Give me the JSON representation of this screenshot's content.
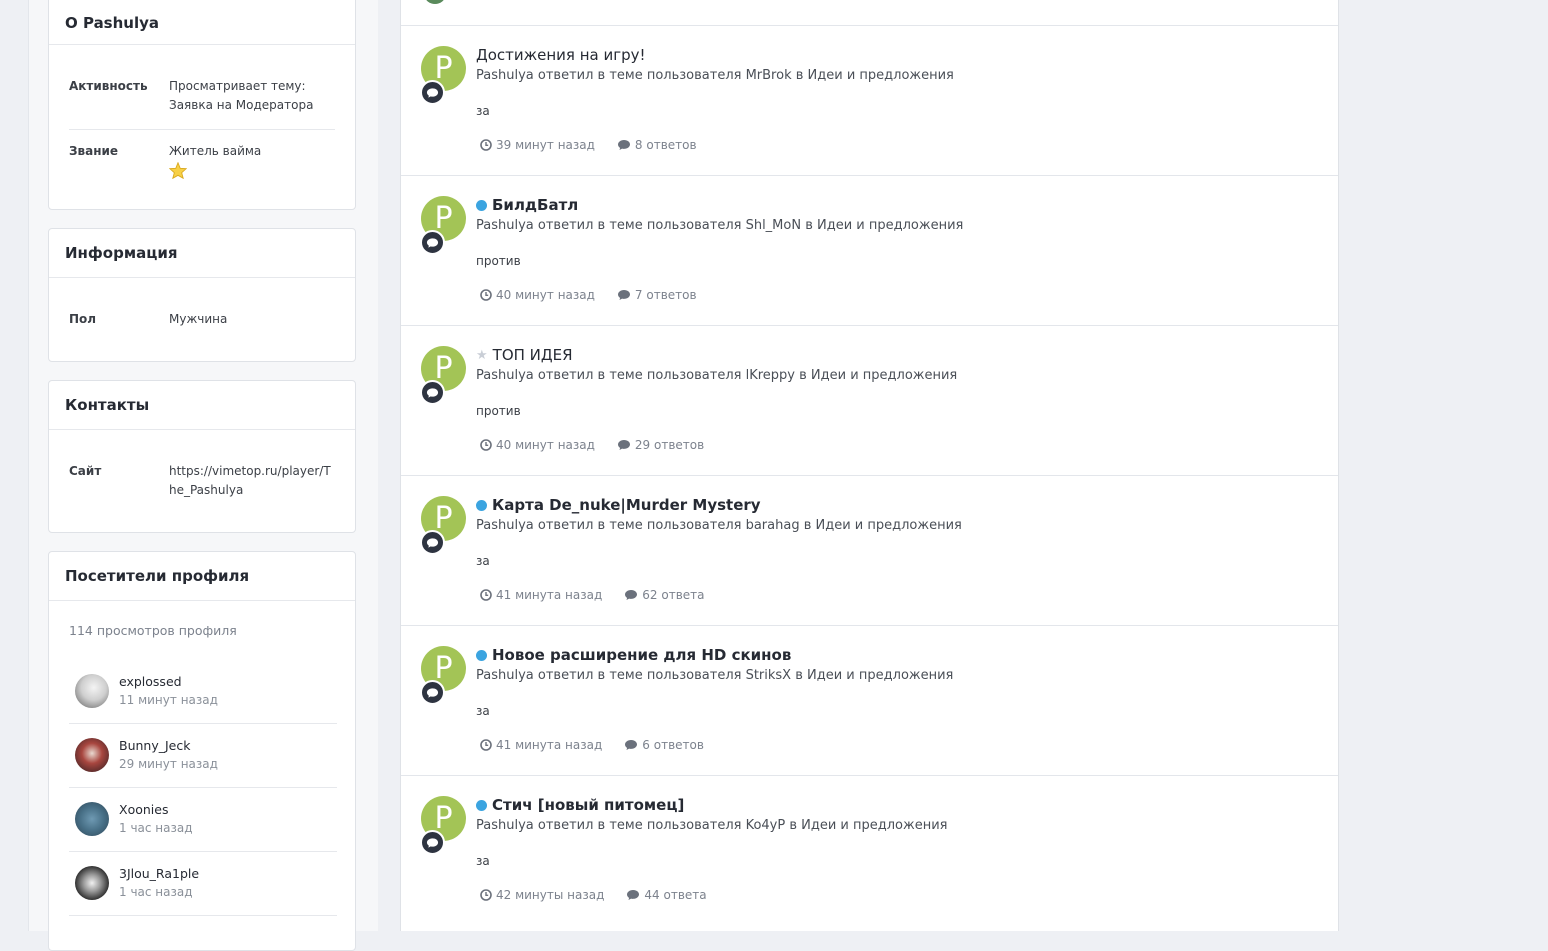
{
  "about": {
    "title": "О Pashulya",
    "rows": [
      {
        "label": "Активность",
        "value": "Просматривает тему: Заявка на Модератора"
      },
      {
        "label": "Звание",
        "value": "Житель вайма"
      }
    ]
  },
  "info": {
    "title": "Информация",
    "rows": [
      {
        "label": "Пол",
        "value": "Мужчина"
      }
    ]
  },
  "contacts": {
    "title": "Контакты",
    "rows": [
      {
        "label": "Сайт",
        "value": "https://vimetop.ru/player/The_Pashulya"
      }
    ]
  },
  "visitors": {
    "title": "Посетители профиля",
    "views": "114 просмотров профиля",
    "items": [
      {
        "name": "explossed",
        "time": "11 минут назад"
      },
      {
        "name": "Bunny_Jeck",
        "time": "29 минут назад"
      },
      {
        "name": "Xoonies",
        "time": "1 час назад"
      },
      {
        "name": "3Jlou_Ra1ple",
        "time": "1 час назад"
      }
    ]
  },
  "feed": {
    "items": [
      {
        "avatar_letter": "P",
        "title": "Достижения на игру!",
        "style": "plain",
        "subtitle": "Pashulya ответил в теме пользователя MrBrok в Идеи и предложения",
        "vote": "за",
        "time": "39 минут назад",
        "replies": "8 ответов"
      },
      {
        "avatar_letter": "P",
        "title": "БилдБатл",
        "style": "dot",
        "subtitle": "Pashulya ответил в теме пользователя Shl_MoN в Идеи и предложения",
        "vote": "против",
        "time": "40 минут назад",
        "replies": "7 ответов"
      },
      {
        "avatar_letter": "P",
        "title": "ТОП ИДЕЯ",
        "style": "star",
        "subtitle": "Pashulya ответил в теме пользователя lKreppy в Идеи и предложения",
        "vote": "против",
        "time": "40 минут назад",
        "replies": "29 ответов"
      },
      {
        "avatar_letter": "P",
        "title": "Карта De_nuke|Murder Mystery",
        "style": "dot",
        "subtitle": "Pashulya ответил в теме пользователя barahag в Идеи и предложения",
        "vote": "за",
        "time": "41 минута назад",
        "replies": "62 ответа"
      },
      {
        "avatar_letter": "P",
        "title": "Новое расширение для HD скинов",
        "style": "dot",
        "subtitle": "Pashulya ответил в теме пользователя StriksX в Идеи и предложения",
        "vote": "за",
        "time": "41 минута назад",
        "replies": "6 ответов"
      },
      {
        "avatar_letter": "P",
        "title": "Стич [новый питомец]",
        "style": "dot",
        "subtitle": "Pashulya ответил в теме пользователя Ko4yP в Идеи и предложения",
        "vote": "за",
        "time": "42 минуты назад",
        "replies": "44 ответа"
      }
    ]
  },
  "colors": {
    "avatar_green": "#a3c456",
    "unread_dot": "#3ba4e0",
    "badge_dark": "#2e3441"
  },
  "icons": {
    "comment_badge": "speech-bubble-icon",
    "time": "clock-icon",
    "replies": "comment-icon",
    "rank": "star-icon"
  }
}
